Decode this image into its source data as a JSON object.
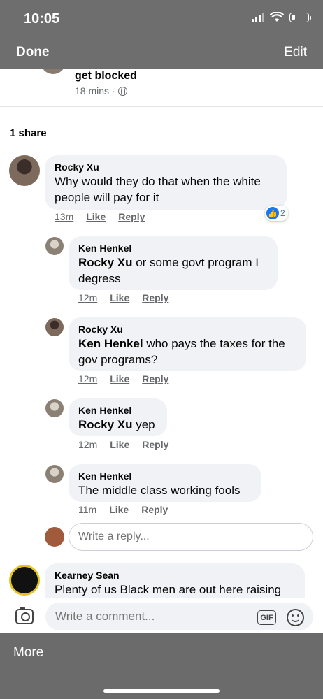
{
  "status_bar": {
    "time": "10:05"
  },
  "nav": {
    "done_label": "Done",
    "edit_label": "Edit"
  },
  "post": {
    "title_line": "get blocked",
    "time": "18 mins",
    "separator": "·"
  },
  "shares": "1 share",
  "comments": [
    {
      "author": "Rocky Xu",
      "mention": "",
      "text": "Why would they do that when the white people will pay for it",
      "time": "13m",
      "like": "Like",
      "reply": "Reply",
      "reaction_count": "2",
      "reaction_icon": "thumbs-up-icon"
    },
    {
      "author": "Ken Henkel",
      "mention": "Rocky Xu",
      "text": " or some govt program I degress",
      "time": "12m",
      "like": "Like",
      "reply": "Reply"
    },
    {
      "author": "Rocky Xu",
      "mention": "Ken Henkel",
      "text": " who pays the taxes for the gov programs?",
      "time": "12m",
      "like": "Like",
      "reply": "Reply"
    },
    {
      "author": "Ken Henkel",
      "mention": "Rocky Xu",
      "text": " yep",
      "time": "12m",
      "like": "Like",
      "reply": "Reply"
    },
    {
      "author": "Ken Henkel",
      "mention": "",
      "text": "The middle class working fools",
      "time": "11m",
      "like": "Like",
      "reply": "Reply"
    },
    {
      "author": "Kearney Sean",
      "mention": "",
      "text": "Plenty of us Black men are out here raising"
    }
  ],
  "reply_field": {
    "placeholder": "Write a reply..."
  },
  "comment_bar": {
    "placeholder": "Write a comment...",
    "gif_label": "GIF"
  },
  "bottom_sheet": {
    "more_label": "More"
  },
  "colors": {
    "accent": "#1877f2",
    "bubble": "#f0f2f5",
    "muted": "#65676b",
    "overlay": "#6b6b6b"
  }
}
